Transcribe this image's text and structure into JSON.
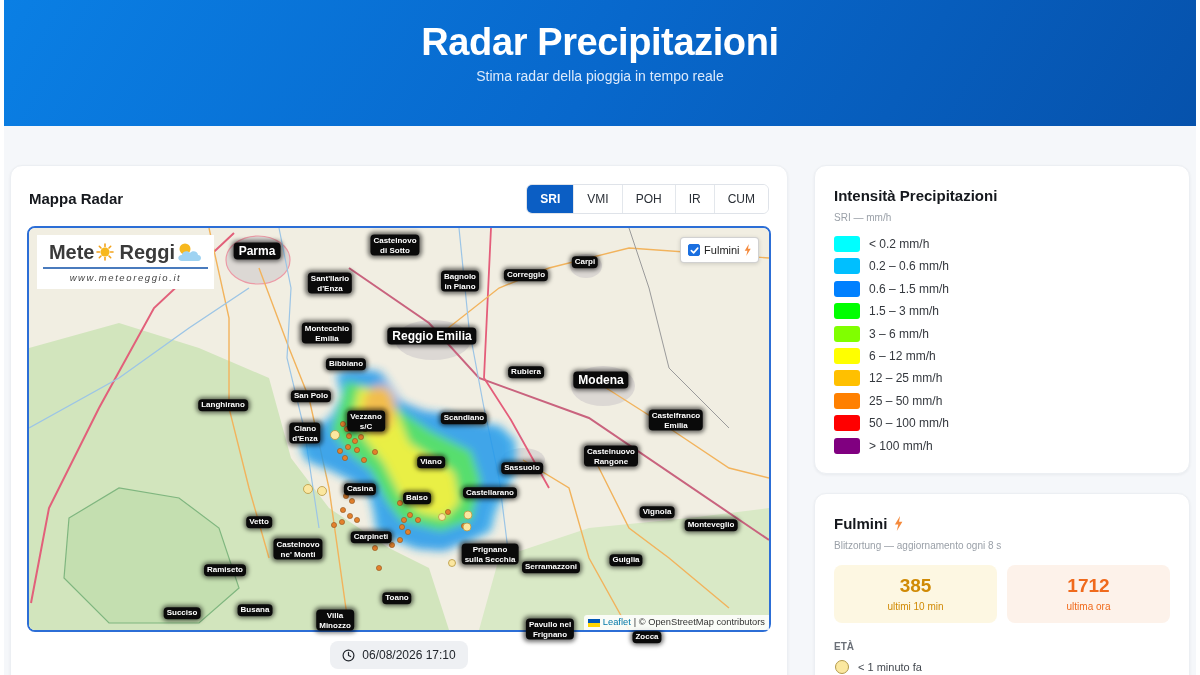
{
  "header": {
    "title": "Radar Precipitazioni",
    "subtitle": "Stima radar della pioggia in tempo reale"
  },
  "map_panel": {
    "title": "Mappa Radar",
    "tabs": [
      {
        "label": "SRI",
        "selected": true
      },
      {
        "label": "VMI",
        "selected": false
      },
      {
        "label": "POH",
        "selected": false
      },
      {
        "label": "IR",
        "selected": false
      },
      {
        "label": "CUM",
        "selected": false
      }
    ],
    "map": {
      "logo": {
        "word_1": "Mete",
        "word_2": "Reggi",
        "url": "www.meteoreggio.it"
      },
      "lightning_toggle": {
        "label": "Fulmini",
        "checked": true
      },
      "place_labels": [
        {
          "text": "Parma",
          "kind": "major"
        },
        {
          "text": "Castelnovo di Sotto",
          "kind": "minor"
        },
        {
          "text": "Carpi",
          "kind": "minor"
        },
        {
          "text": "Sant'Ilario d'Enza",
          "kind": "minor"
        },
        {
          "text": "Bagnolo in Piano",
          "kind": "minor"
        },
        {
          "text": "Correggio",
          "kind": "minor"
        },
        {
          "text": "Montecchio Emilia",
          "kind": "minor"
        },
        {
          "text": "Reggio Emilia",
          "kind": "major"
        },
        {
          "text": "Bibbiano",
          "kind": "minor"
        },
        {
          "text": "Rubiera",
          "kind": "minor"
        },
        {
          "text": "Modena",
          "kind": "major"
        },
        {
          "text": "Langhirano",
          "kind": "minor"
        },
        {
          "text": "San Polo",
          "kind": "minor"
        },
        {
          "text": "Ciano d'Enza",
          "kind": "minor"
        },
        {
          "text": "Vezzano s/C",
          "kind": "minor"
        },
        {
          "text": "Scandiano",
          "kind": "minor"
        },
        {
          "text": "Castelfranco Emilia",
          "kind": "minor"
        },
        {
          "text": "Viano",
          "kind": "minor"
        },
        {
          "text": "Sassuolo",
          "kind": "minor"
        },
        {
          "text": "Castelnuovo Rangone",
          "kind": "minor"
        },
        {
          "text": "Casina",
          "kind": "minor"
        },
        {
          "text": "Baiso",
          "kind": "minor"
        },
        {
          "text": "Castellarano",
          "kind": "minor"
        },
        {
          "text": "Vetto",
          "kind": "minor"
        },
        {
          "text": "Vignola",
          "kind": "minor"
        },
        {
          "text": "Monteveglio",
          "kind": "minor"
        },
        {
          "text": "Castelnovo ne' Monti",
          "kind": "minor"
        },
        {
          "text": "Carpineti",
          "kind": "minor"
        },
        {
          "text": "Ramiseto",
          "kind": "minor"
        },
        {
          "text": "Prignano sulla Secchia",
          "kind": "minor"
        },
        {
          "text": "Serramazzoni",
          "kind": "minor"
        },
        {
          "text": "Guiglia",
          "kind": "minor"
        },
        {
          "text": "Toano",
          "kind": "minor"
        },
        {
          "text": "Succiso",
          "kind": "minor"
        },
        {
          "text": "Busana",
          "kind": "minor"
        },
        {
          "text": "Villa Minozzo",
          "kind": "minor"
        },
        {
          "text": "Pavullo nel Frignano",
          "kind": "minor"
        },
        {
          "text": "Zocca",
          "kind": "minor"
        }
      ],
      "attribution": {
        "link": "Leaflet",
        "text": "| © OpenStreetMap contributors"
      }
    },
    "timestamp": "06/08/2026 17:10"
  },
  "legend": {
    "title": "Intensità Precipitazioni",
    "subtitle": "SRI — mm/h",
    "items": [
      {
        "label": "< 0.2 mm/h",
        "color": "#00ffff"
      },
      {
        "label": "0.2 – 0.6 mm/h",
        "color": "#00bfff"
      },
      {
        "label": "0.6 – 1.5 mm/h",
        "color": "#0080ff"
      },
      {
        "label": "1.5 – 3 mm/h",
        "color": "#00ff00"
      },
      {
        "label": "3 – 6 mm/h",
        "color": "#80ff00"
      },
      {
        "label": "6 – 12 mm/h",
        "color": "#ffff00"
      },
      {
        "label": "12 – 25 mm/h",
        "color": "#ffc000"
      },
      {
        "label": "25 – 50 mm/h",
        "color": "#ff8000"
      },
      {
        "label": "50 – 100 mm/h",
        "color": "#ff0000"
      },
      {
        "label": "> 100 mm/h",
        "color": "#800080"
      }
    ]
  },
  "lightning": {
    "title": "Fulmini",
    "subtitle": "Blitzortung — aggiornamento ogni 8 s",
    "stats": [
      {
        "value": "385",
        "label": "ultimi 10 min",
        "kind": "recent"
      },
      {
        "value": "1712",
        "label": "ultima ora",
        "kind": "hour"
      }
    ],
    "age_heading": "ETÀ",
    "age_legend": [
      {
        "label": "< 1 minuto fa",
        "color": "#fbe8a0"
      }
    ]
  }
}
